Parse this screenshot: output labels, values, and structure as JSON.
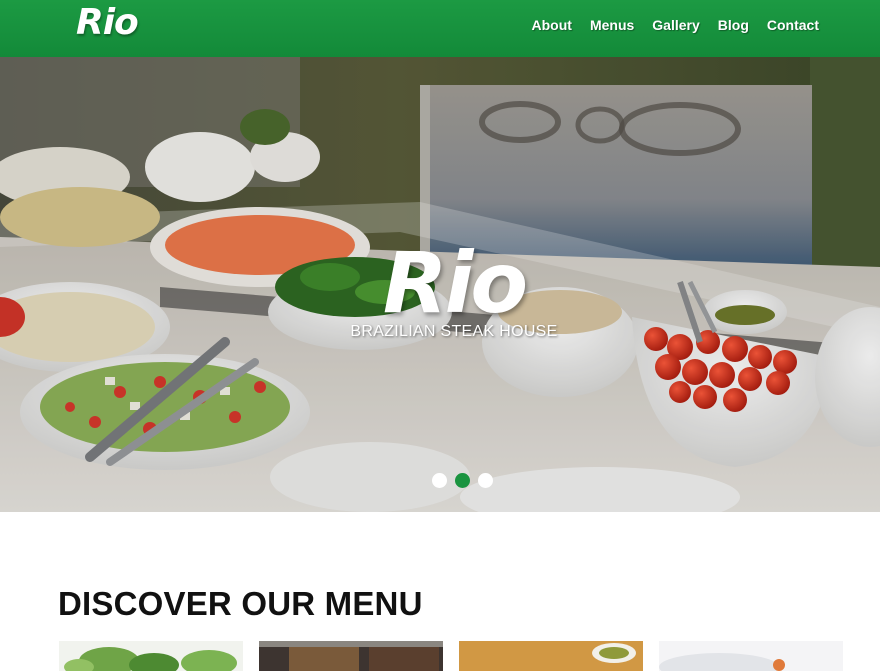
{
  "header": {
    "logo": "Rio",
    "nav": [
      "About",
      "Menus",
      "Gallery",
      "Blog",
      "Contact"
    ],
    "background_color": "#138a39"
  },
  "hero": {
    "title": "Rio",
    "subtitle": "BRAZILIAN STEAK HOUSE",
    "slides": {
      "count": 3,
      "active_index": 1
    },
    "active_dot_color": "#1a9440"
  },
  "discover": {
    "title": "DISCOVER OUR MENU",
    "thumbnails": [
      "salad-greens",
      "grilled-meat",
      "wooden-board-dip",
      "plated-dish"
    ]
  }
}
